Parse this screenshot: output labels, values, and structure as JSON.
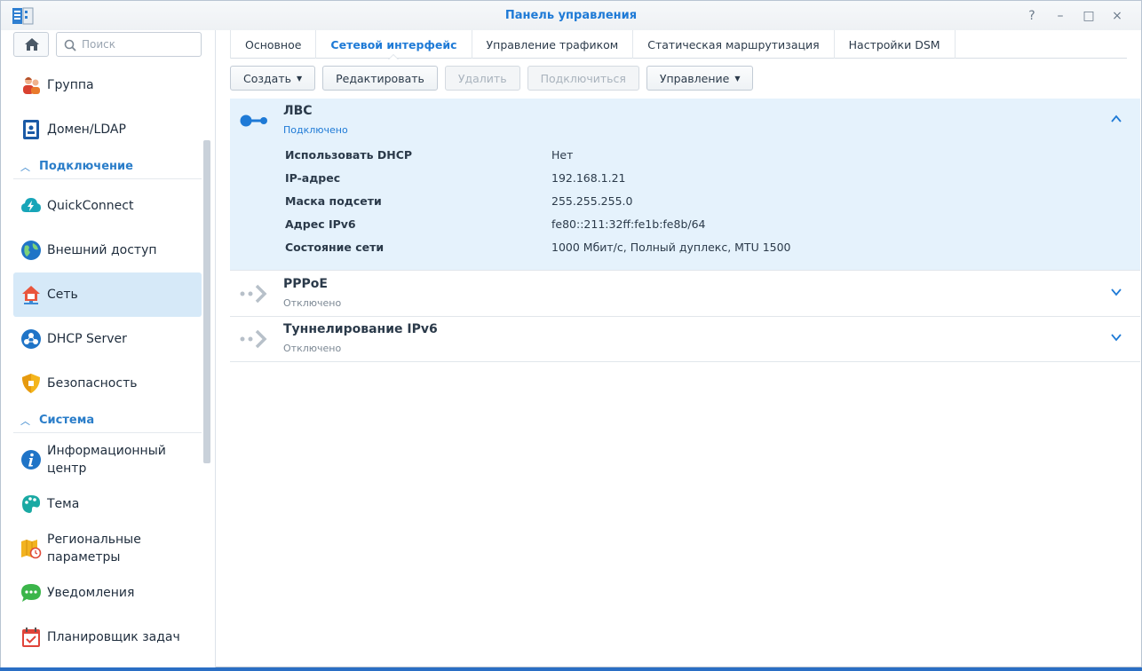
{
  "window": {
    "title": "Панель управления",
    "controls": [
      "?",
      "–",
      "□",
      "×"
    ]
  },
  "sidebar": {
    "search_placeholder": "Поиск",
    "items": [
      {
        "label": "Группа",
        "icon": "group-icon"
      },
      {
        "label": "Домен/LDAP",
        "icon": "domain-ldap-icon"
      },
      {
        "section": "Подключение"
      },
      {
        "label": "QuickConnect",
        "icon": "quickconnect-icon"
      },
      {
        "label": "Внешний доступ",
        "icon": "external-access-icon"
      },
      {
        "label": "Сеть",
        "icon": "network-icon",
        "active": true
      },
      {
        "label": "DHCP Server",
        "icon": "dhcp-server-icon"
      },
      {
        "label": "Безопасность",
        "icon": "security-icon"
      },
      {
        "section": "Система"
      },
      {
        "label": "Информационный центр",
        "icon": "info-center-icon"
      },
      {
        "label": "Тема",
        "icon": "theme-icon"
      },
      {
        "label": "Региональные параметры",
        "icon": "regional-options-icon"
      },
      {
        "label": "Уведомления",
        "icon": "notification-icon"
      },
      {
        "label": "Планировщик задач",
        "icon": "task-scheduler-icon"
      }
    ]
  },
  "tabs": [
    {
      "label": "Основное"
    },
    {
      "label": "Сетевой интерфейс",
      "active": true
    },
    {
      "label": "Управление трафиком"
    },
    {
      "label": "Статическая маршрутизация"
    },
    {
      "label": "Настройки DSM"
    }
  ],
  "toolbar": {
    "create": "Создать",
    "edit": "Редактировать",
    "delete": "Удалить",
    "connect": "Подключиться",
    "manage": "Управление"
  },
  "interfaces": [
    {
      "name": "ЛВС",
      "status": "Подключено",
      "expanded": true,
      "details": [
        {
          "key": "Использовать DHCP",
          "value": "Нет"
        },
        {
          "key": "IP-адрес",
          "value": "192.168.1.21"
        },
        {
          "key": "Маска подсети",
          "value": "255.255.255.0"
        },
        {
          "key": "Адрес IPv6",
          "value": "fe80::211:32ff:fe1b:fe8b/64"
        },
        {
          "key": "Состояние сети",
          "value": "1000 Мбит/с, Полный дуплекс, MTU 1500"
        }
      ]
    },
    {
      "name": "PPPoE",
      "status": "Отключено",
      "expanded": false
    },
    {
      "name": "Туннелирование IPv6",
      "status": "Отключено",
      "expanded": false
    }
  ],
  "colors": {
    "accent": "#1e7ad6",
    "active_bg": "#d6e9f8",
    "expanded_bg": "#e5f2fc"
  }
}
